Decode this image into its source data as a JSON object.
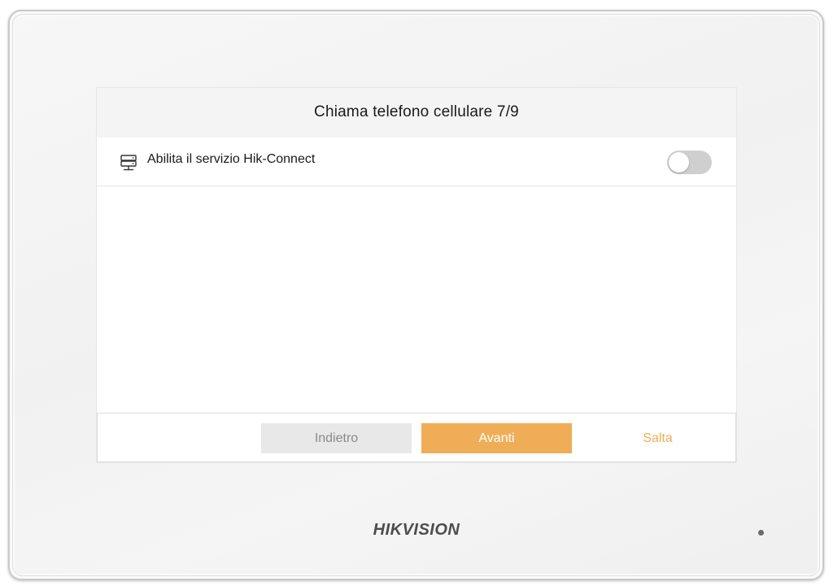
{
  "dialog": {
    "title": "Chiama telefono cellulare 7/9"
  },
  "settings": {
    "hik_connect": {
      "icon": "server-icon",
      "label": "Abilita il servizio Hik-Connect",
      "enabled": false
    }
  },
  "footer": {
    "back_label": "Indietro",
    "next_label": "Avanti",
    "skip_label": "Salta"
  },
  "device": {
    "brand": "HIKVISION"
  },
  "colors": {
    "accent": "#f0ad58",
    "toggle_off": "#cfcfcf",
    "back_button": "#e8e8e8",
    "title_bar": "#f4f4f4"
  }
}
